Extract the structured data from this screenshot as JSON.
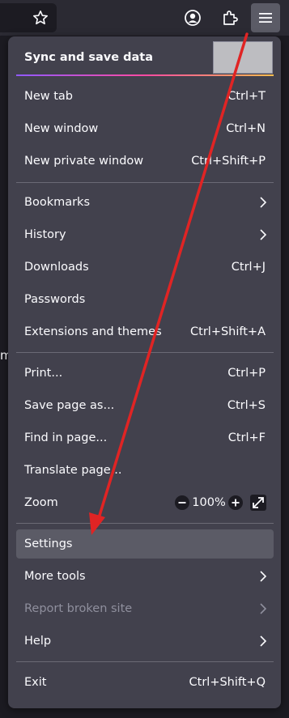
{
  "toolbar": {
    "bookmark_icon": "star-icon",
    "account_icon": "account-icon",
    "extensions_icon": "puzzle-icon",
    "menu_icon": "hamburger-icon"
  },
  "page": {
    "glyph": "m"
  },
  "menu": {
    "header": {
      "title": "Sync and save data"
    },
    "items": {
      "new_tab": {
        "label": "New tab",
        "shortcut": "Ctrl+T"
      },
      "new_window": {
        "label": "New window",
        "shortcut": "Ctrl+N"
      },
      "new_private": {
        "label": "New private window",
        "shortcut": "Ctrl+Shift+P"
      },
      "bookmarks": {
        "label": "Bookmarks"
      },
      "history": {
        "label": "History"
      },
      "downloads": {
        "label": "Downloads",
        "shortcut": "Ctrl+J"
      },
      "passwords": {
        "label": "Passwords"
      },
      "extensions": {
        "label": "Extensions and themes",
        "shortcut": "Ctrl+Shift+A"
      },
      "print": {
        "label": "Print...",
        "shortcut": "Ctrl+P"
      },
      "save_page": {
        "label": "Save page as...",
        "shortcut": "Ctrl+S"
      },
      "find": {
        "label": "Find in page...",
        "shortcut": "Ctrl+F"
      },
      "translate": {
        "label": "Translate page..."
      },
      "zoom": {
        "label": "Zoom",
        "value": "100%"
      },
      "settings": {
        "label": "Settings"
      },
      "more_tools": {
        "label": "More tools"
      },
      "report": {
        "label": "Report broken site"
      },
      "help": {
        "label": "Help"
      },
      "exit": {
        "label": "Exit",
        "shortcut": "Ctrl+Shift+Q"
      }
    }
  },
  "colors": {
    "menu_bg": "#42414d",
    "highlight_bg": "#5b5b66",
    "annotation_arrow": "#e02424"
  }
}
